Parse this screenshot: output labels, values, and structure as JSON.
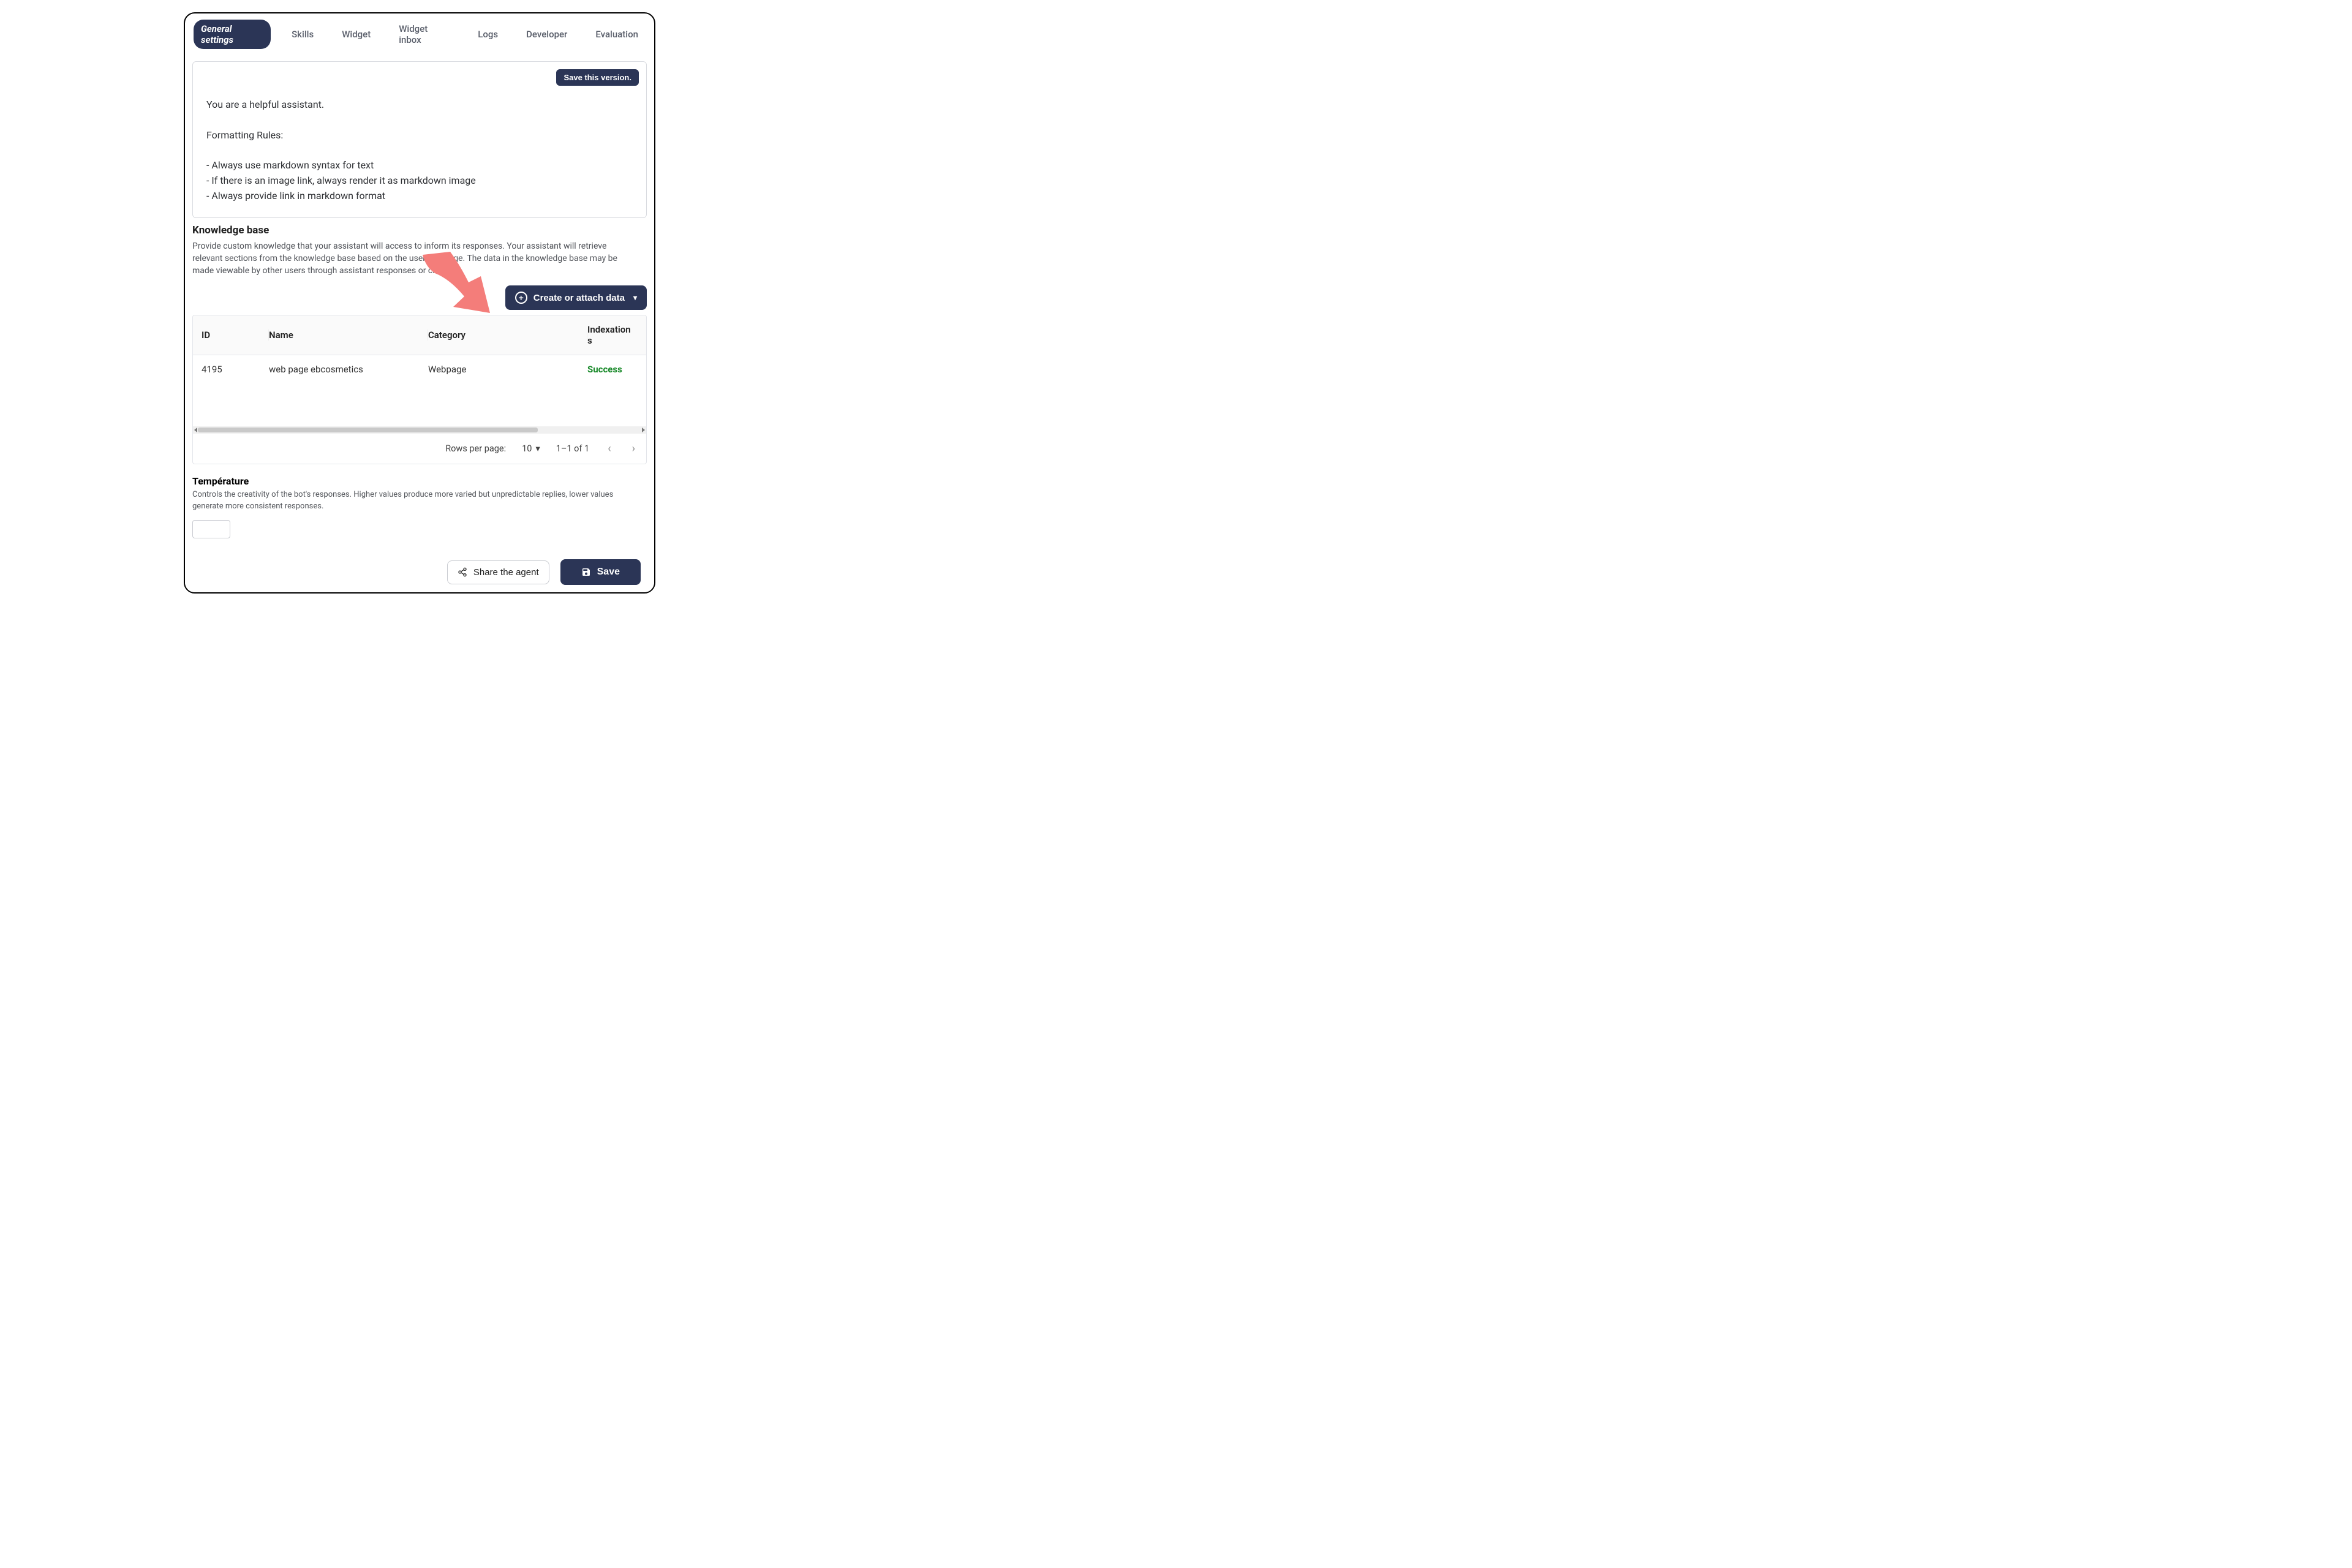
{
  "tabs": {
    "items": [
      {
        "label": "General settings",
        "active": true
      },
      {
        "label": "Skills",
        "active": false
      },
      {
        "label": "Widget",
        "active": false
      },
      {
        "label": "Widget inbox",
        "active": false
      },
      {
        "label": "Logs",
        "active": false
      },
      {
        "label": "Developer",
        "active": false
      },
      {
        "label": "Evaluation",
        "active": false
      }
    ]
  },
  "prompt": {
    "save_version_label": "Save this version.",
    "text": "You are a helpful assistant.\n\nFormatting Rules:\n\n- Always use markdown syntax for text\n- If there is an image link, always render it as markdown image\n- Always provide link in markdown format"
  },
  "knowledge_base": {
    "title": "Knowledge base",
    "description": "Provide custom knowledge that your assistant will access to inform its responses. Your assistant will retrieve relevant sections from the knowledge base based on the user message. The data in the knowledge base may be made viewable by other users through assistant responses or citations.",
    "create_attach_label": "Create or attach data",
    "columns": {
      "id": "ID",
      "name": "Name",
      "category": "Category",
      "status": "Indexation s"
    },
    "rows": [
      {
        "id": "4195",
        "name": "web page ebcosmetics",
        "category": "Webpage",
        "status": "Success"
      }
    ],
    "pager": {
      "rows_per_page_label": "Rows per page:",
      "rows_per_page_value": "10",
      "range": "1–1 of 1"
    }
  },
  "temperature": {
    "title": "Température",
    "description": " Controls the creativity of the bot's responses. Higher values produce more varied but unpredictable replies, lower values generate more consistent responses."
  },
  "footer": {
    "share_label": "Share the agent",
    "save_label": "Save"
  },
  "colors": {
    "primary": "#2b3556",
    "success": "#1a8a2b",
    "arrow": "#f47d7a"
  }
}
